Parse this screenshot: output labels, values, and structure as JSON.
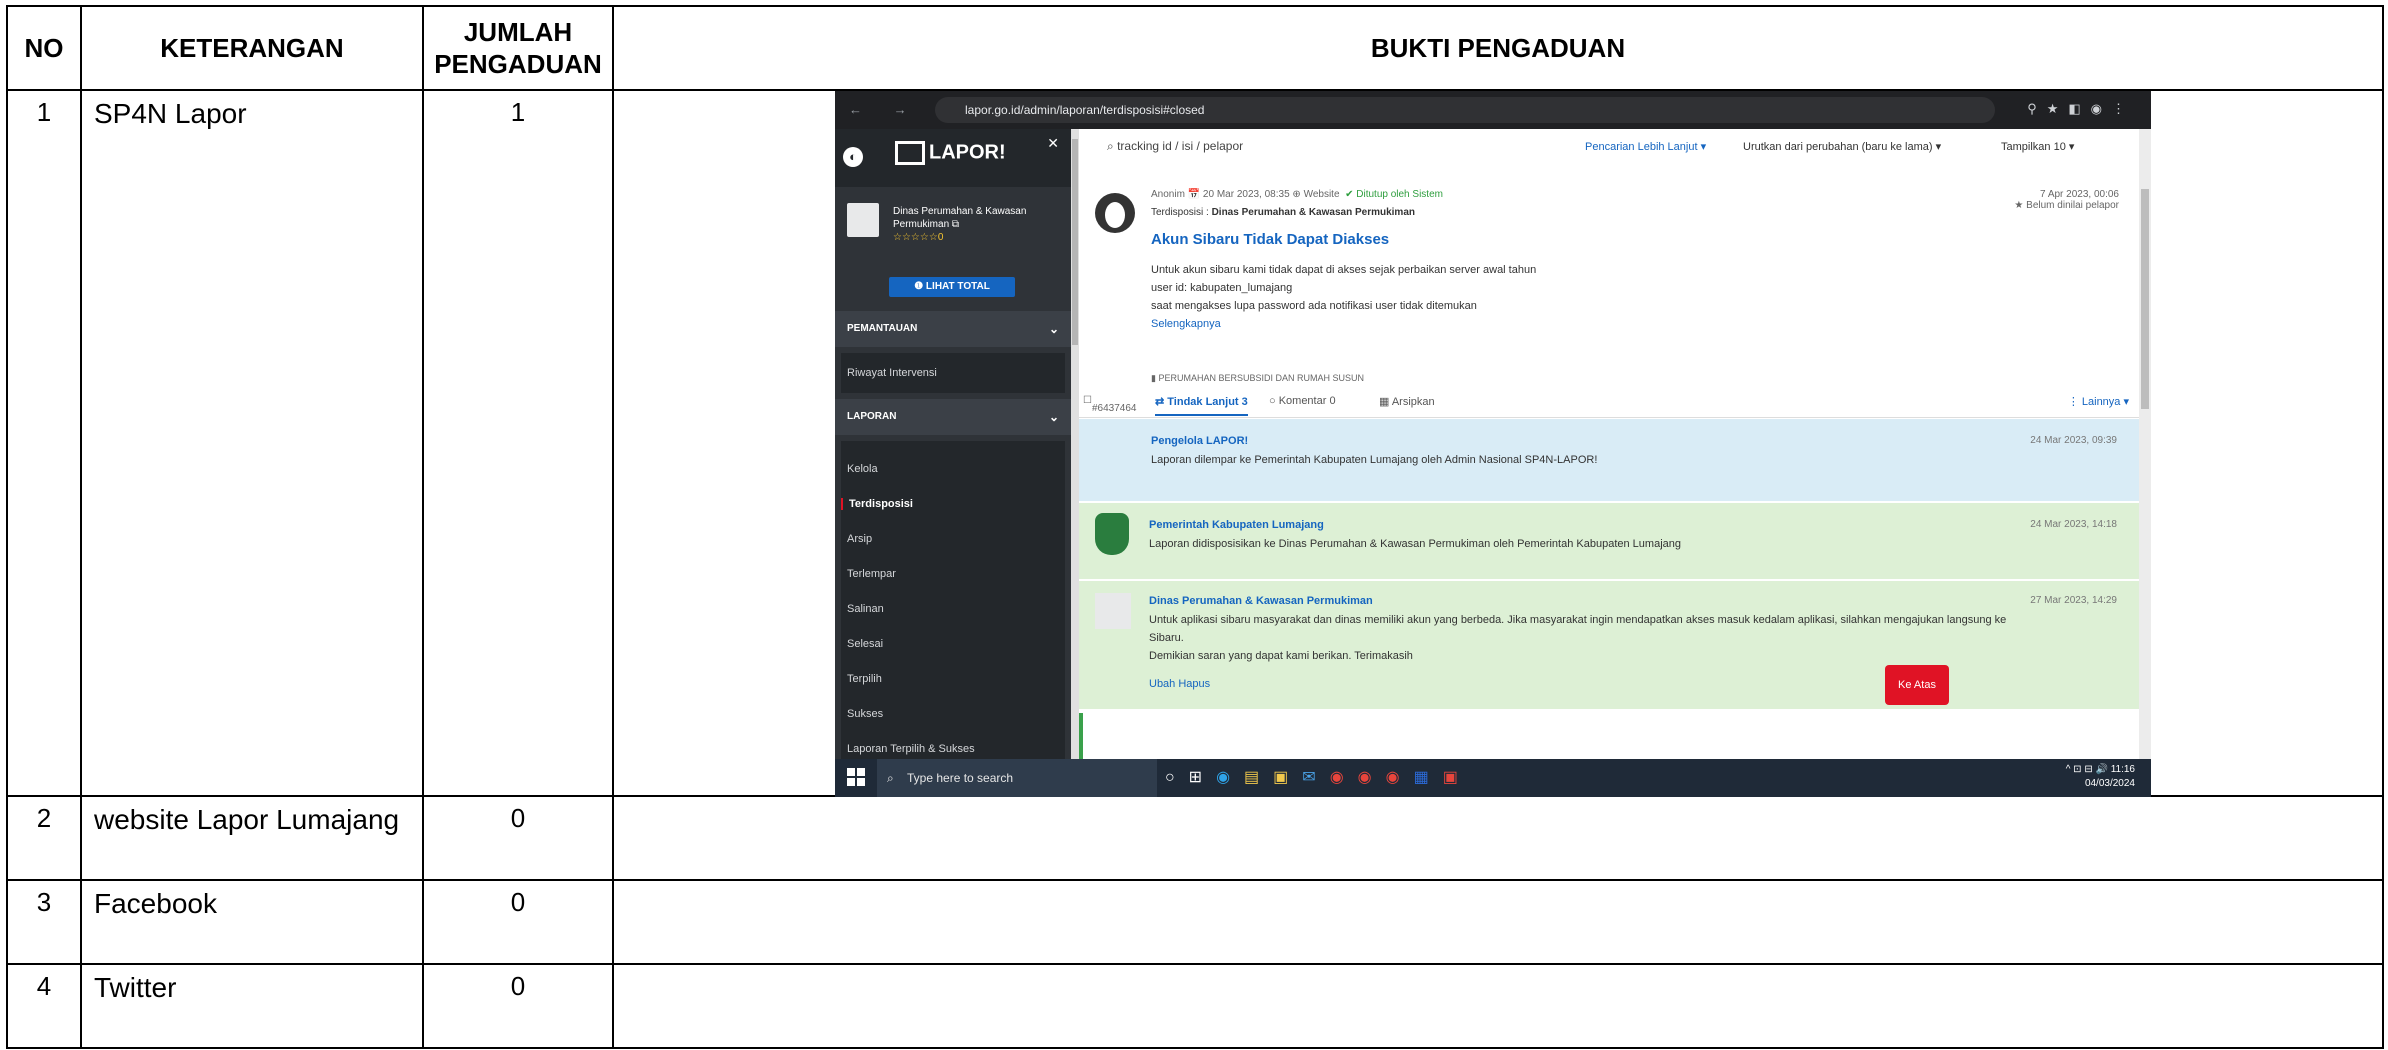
{
  "table": {
    "headers": {
      "no": "NO",
      "keterangan": "KETERANGAN",
      "jumlah_line1": "JUMLAH",
      "jumlah_line2": "PENGADUAN",
      "bukti": "BUKTI PENGADUAN"
    },
    "rows": [
      {
        "no": "1",
        "keterangan": "SP4N Lapor",
        "jumlah": "1"
      },
      {
        "no": "2",
        "keterangan": "website Lapor Lumajang",
        "jumlah": "0"
      },
      {
        "no": "3",
        "keterangan": "Facebook",
        "jumlah": "0"
      },
      {
        "no": "4",
        "keterangan": "Twitter",
        "jumlah": "0"
      }
    ]
  },
  "screenshot": {
    "browser": {
      "url": "lapor.go.id/admin/laporan/terdisposisi#closed",
      "nav": "← → C"
    },
    "sidebar": {
      "logo": "LAPOR!",
      "agency_name": "Dinas Perumahan & Kawasan Permukiman",
      "rating": "☆☆☆☆☆0",
      "lihat_total": "❶ LIHAT TOTAL",
      "section_pemantauan": "PEMANTAUAN",
      "item_riwayat": "Riwayat Intervensi",
      "section_laporan": "LAPORAN",
      "items": [
        "Kelola",
        "Terdisposisi",
        "Arsip",
        "Terlempar",
        "Salinan",
        "Selesai",
        "Terpilih",
        "Sukses",
        "Laporan Terpilih & Sukses"
      ]
    },
    "search": {
      "placeholder": "tracking id / isi / pelapor",
      "advanced": "Pencarian Lebih Lanjut ▾",
      "sort": "Urutkan dari perubahan (baru ke lama) ▾",
      "show": "Tampilkan 10 ▾"
    },
    "post": {
      "meta": "Anonim  📅 20 Mar 2023, 08:35   ⊕ Website",
      "status": "✔ Ditutup oleh Sistem",
      "date": "7 Apr 2023, 00:06",
      "rating_note": "★ Belum dinilai pelapor",
      "dispo_label": "Terdisposisi : ",
      "dispo_value": "Dinas Perumahan & Kawasan Permukiman",
      "title": "Akun Sibaru Tidak Dapat Diakses",
      "body_1": "Untuk akun sibaru kami tidak dapat di akses sejak perbaikan server awal tahun",
      "body_2": "user id: kabupaten_lumajang",
      "body_3": "saat mengakses lupa password ada notifikasi user tidak ditemukan",
      "more": "Selengkapnya",
      "category": "▮ PERUMAHAN BERSUBSIDI DAN RUMAH SUSUN"
    },
    "tabs": {
      "id": "#6437464",
      "tindak": "⇄ Tindak Lanjut 3",
      "komentar": "○ Komentar 0",
      "arsipkan": "▦ Arsipkan",
      "lainnya": "⋮ Lainnya ▾"
    },
    "feed": [
      {
        "who": "Pengelola LAPOR!",
        "text": "Laporan dilempar ke Pemerintah Kabupaten Lumajang oleh Admin Nasional SP4N-LAPOR!",
        "date": "24 Mar 2023, 09:39"
      },
      {
        "who": "Pemerintah Kabupaten Lumajang",
        "text": "Laporan didisposisikan ke Dinas Perumahan & Kawasan Permukiman oleh Pemerintah Kabupaten Lumajang",
        "date": "24 Mar 2023, 14:18"
      },
      {
        "who": "Dinas Perumahan & Kawasan Permukiman",
        "text_1": "Untuk aplikasi sibaru masyarakat dan dinas memiliki akun yang berbeda. Jika masyarakat ingin mendapatkan akses masuk kedalam aplikasi, silahkan mengajukan langsung ke",
        "text_2": "Sibaru.",
        "text_3": "Demikian saran yang dapat kami berikan. Terimakasih",
        "actions": "Ubah   Hapus",
        "date": "27 Mar 2023, 14:29"
      }
    ],
    "ke_atas": "Ke Atas",
    "taskbar": {
      "search": "Type here to search",
      "time": "11:16",
      "date": "04/03/2024"
    }
  }
}
